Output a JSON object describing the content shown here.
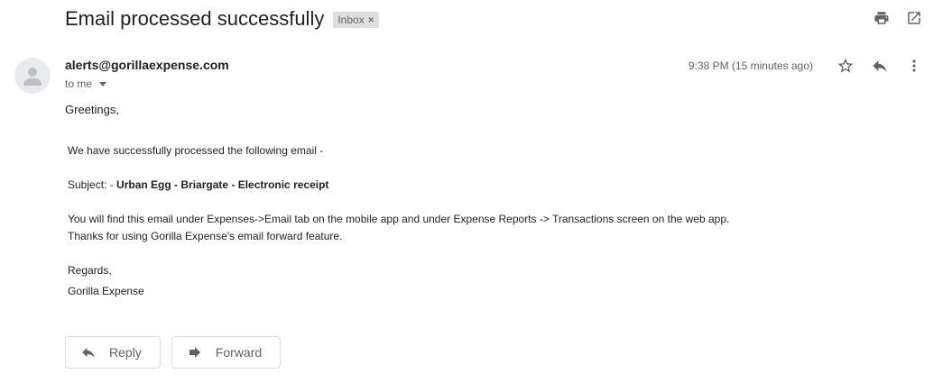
{
  "subject": "Email processed successfully",
  "label": {
    "text": "Inbox",
    "remove": "×"
  },
  "sender": "alerts@gorillaexpense.com",
  "recipient": "to me",
  "timestamp": "9:38 PM (15 minutes ago)",
  "body": {
    "greeting": "Greetings,",
    "line1": "We have successfully processed the following email -",
    "subject_prefix": "Subject: - ",
    "subject_value": "Urban Egg - Briargate - Electronic receipt",
    "line3": "You will find this email under Expenses->Email tab on the mobile app and under Expense Reports -> Transactions screen on the web app.",
    "line4": "Thanks for using Gorilla Expense's email forward feature.",
    "regards": "Regards,",
    "signature": "Gorilla Expense"
  },
  "actions": {
    "reply": "Reply",
    "forward": "Forward"
  },
  "icons": [
    "print-icon",
    "open-in-new-window-icon",
    "star-icon",
    "reply-icon",
    "more-vert-icon",
    "avatar-person-icon"
  ]
}
